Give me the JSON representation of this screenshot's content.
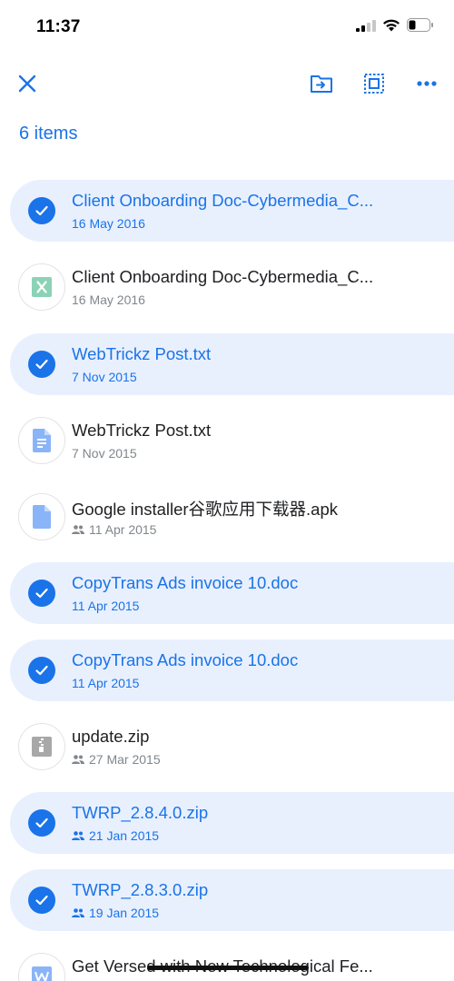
{
  "status_bar": {
    "time": "11:37"
  },
  "toolbar": {
    "close_icon": "close-icon",
    "move_icon": "folder-move-icon",
    "select_all_icon": "select-all-icon",
    "more_icon": "more-horizontal-icon"
  },
  "items_count": "6 items",
  "colors": {
    "accent": "#1a73e8",
    "selected_bg": "#e8f0fe",
    "meta": "#80868b"
  },
  "files": [
    {
      "name": "Client Onboarding Doc-Cybermedia_C...",
      "date": "16 May 2016",
      "selected": true,
      "shared": false,
      "icon": "check-icon"
    },
    {
      "name": "Client Onboarding Doc-Cybermedia_C...",
      "date": "16 May 2016",
      "selected": false,
      "shared": false,
      "icon": "spreadsheet-icon"
    },
    {
      "name": "WebTrickz Post.txt",
      "date": "7 Nov 2015",
      "selected": true,
      "shared": false,
      "icon": "check-icon"
    },
    {
      "name": "WebTrickz Post.txt",
      "date": "7 Nov 2015",
      "selected": false,
      "shared": false,
      "icon": "text-document-icon"
    },
    {
      "name": "Google installer谷歌应用下载器.apk",
      "date": "11 Apr 2015",
      "selected": false,
      "shared": true,
      "icon": "file-icon"
    },
    {
      "name": "CopyTrans Ads invoice 10.doc",
      "date": "11 Apr 2015",
      "selected": true,
      "shared": false,
      "icon": "check-icon"
    },
    {
      "name": "CopyTrans Ads invoice 10.doc",
      "date": "11 Apr 2015",
      "selected": true,
      "shared": false,
      "icon": "check-icon"
    },
    {
      "name": "update.zip",
      "date": "27 Mar 2015",
      "selected": false,
      "shared": true,
      "icon": "zip-icon"
    },
    {
      "name": "TWRP_2.8.4.0.zip",
      "date": "21 Jan 2015",
      "selected": true,
      "shared": true,
      "icon": "check-icon"
    },
    {
      "name": "TWRP_2.8.3.0.zip",
      "date": "19 Jan 2015",
      "selected": true,
      "shared": true,
      "icon": "check-icon"
    },
    {
      "name": "Get Versed with New Technological Fe...",
      "date": "",
      "selected": false,
      "shared": false,
      "icon": "word-document-icon"
    }
  ]
}
